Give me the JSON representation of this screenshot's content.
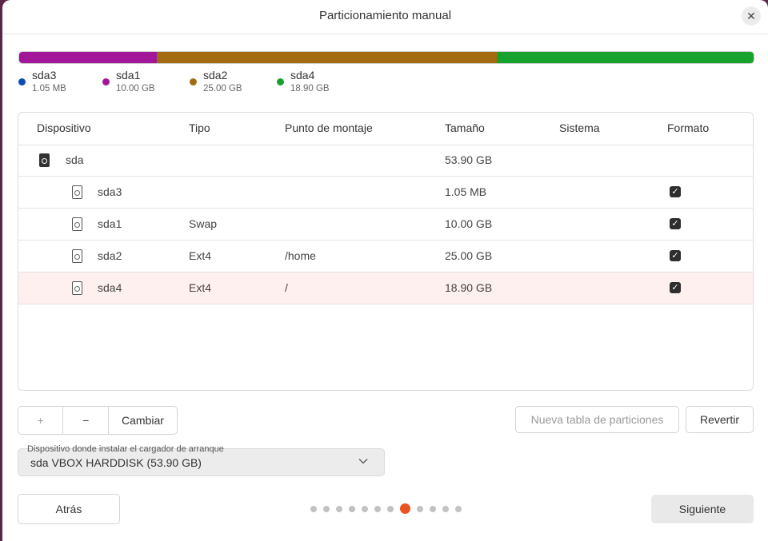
{
  "window": {
    "title": "Particionamiento manual"
  },
  "colors": {
    "sda3": "#0e4bb1",
    "sda1": "#a2179a",
    "sda2": "#a36b0f",
    "sda4": "#17a22d",
    "accent": "#e95420"
  },
  "partition_bar": [
    {
      "name": "sda3",
      "size_gb": 0.001
    },
    {
      "name": "sda1",
      "size_gb": 10.0
    },
    {
      "name": "sda2",
      "size_gb": 25.0
    },
    {
      "name": "sda4",
      "size_gb": 18.9
    }
  ],
  "legend": [
    {
      "name": "sda3",
      "size": "1.05 MB"
    },
    {
      "name": "sda1",
      "size": "10.00 GB"
    },
    {
      "name": "sda2",
      "size": "25.00 GB"
    },
    {
      "name": "sda4",
      "size": "18.90 GB"
    }
  ],
  "table": {
    "headers": {
      "device": "Dispositivo",
      "type": "Tipo",
      "mount": "Punto de montaje",
      "size": "Tamaño",
      "system": "Sistema",
      "format": "Formato"
    },
    "rows": [
      {
        "device": "sda",
        "type": "",
        "mount": "",
        "size": "53.90 GB",
        "format": false
      },
      {
        "device": "sda3",
        "type": "",
        "mount": "",
        "size": "1.05 MB",
        "format": true
      },
      {
        "device": "sda1",
        "type": "Swap",
        "mount": "",
        "size": "10.00 GB",
        "format": true
      },
      {
        "device": "sda2",
        "type": "Ext4",
        "mount": "/home",
        "size": "25.00 GB",
        "format": true
      },
      {
        "device": "sda4",
        "type": "Ext4",
        "mount": "/",
        "size": "18.90 GB",
        "format": true
      }
    ]
  },
  "toolbar": {
    "add_label": "+",
    "remove_label": "−",
    "change_label": "Cambiar",
    "new_table_label": "Nueva tabla de particiones",
    "revert_label": "Revertir"
  },
  "bootloader": {
    "label": "Dispositivo donde instalar el cargador de arranque",
    "value": "sda VBOX HARDDISK (53.90 GB)"
  },
  "footer": {
    "back_label": "Atrás",
    "next_label": "Siguiente",
    "total_steps": 12,
    "current_step": 8
  }
}
